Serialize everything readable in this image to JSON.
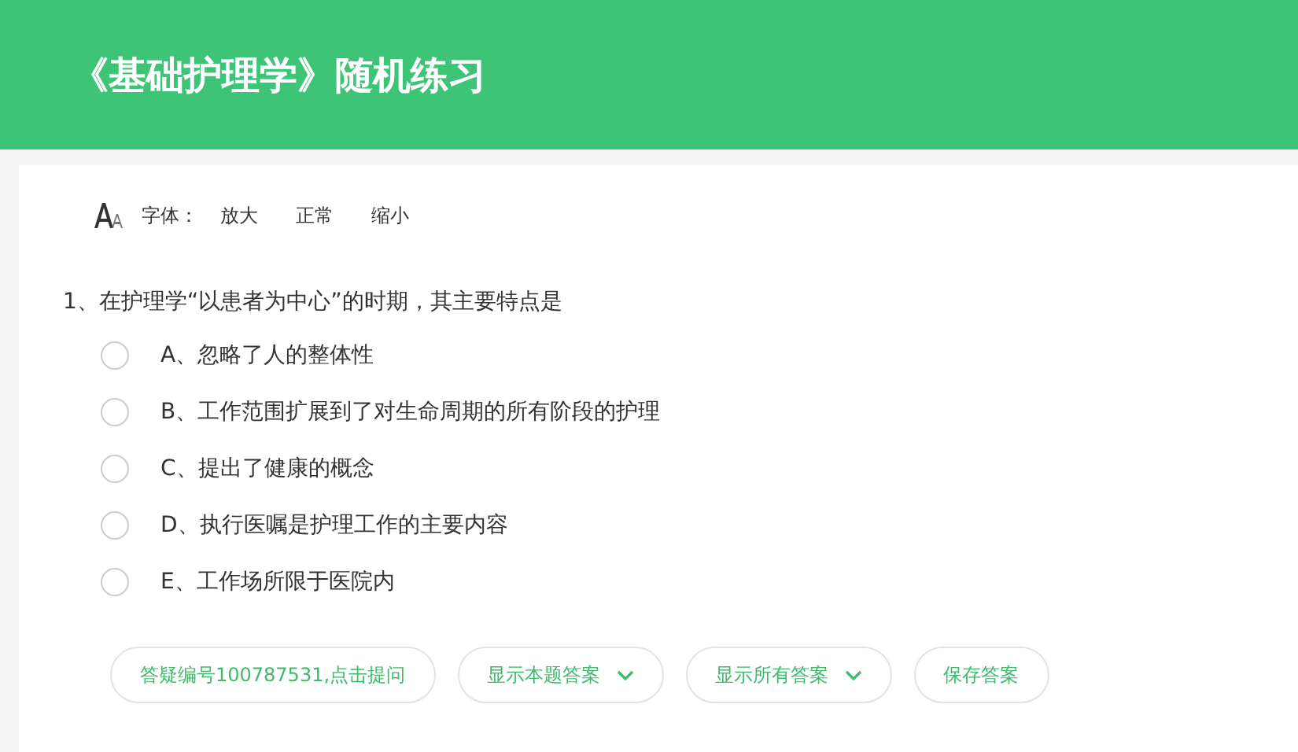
{
  "header": {
    "title": "《基础护理学》随机练习"
  },
  "font_toolbar": {
    "label": "字体：",
    "options": [
      "放大",
      "正常",
      "缩小"
    ]
  },
  "question": {
    "text": "1、在护理学“以患者为中心”的时期，其主要特点是",
    "options": [
      {
        "label": "A、忽略了人的整体性",
        "selected": false
      },
      {
        "label": "B、工作范围扩展到了对生命周期的所有阶段的护理",
        "selected": false
      },
      {
        "label": "C、提出了健康的概念",
        "selected": false
      },
      {
        "label": "D、执行医嘱是护理工作的主要内容",
        "selected": false
      },
      {
        "label": "E、工作场所限于医院内",
        "selected": false
      }
    ]
  },
  "actions": [
    {
      "label": "答疑编号100787531,点击提问",
      "kind": "plain"
    },
    {
      "label": "显示本题答案",
      "kind": "dropdown"
    },
    {
      "label": "显示所有答案",
      "kind": "dropdown"
    },
    {
      "label": "保存答案",
      "kind": "plain"
    }
  ]
}
